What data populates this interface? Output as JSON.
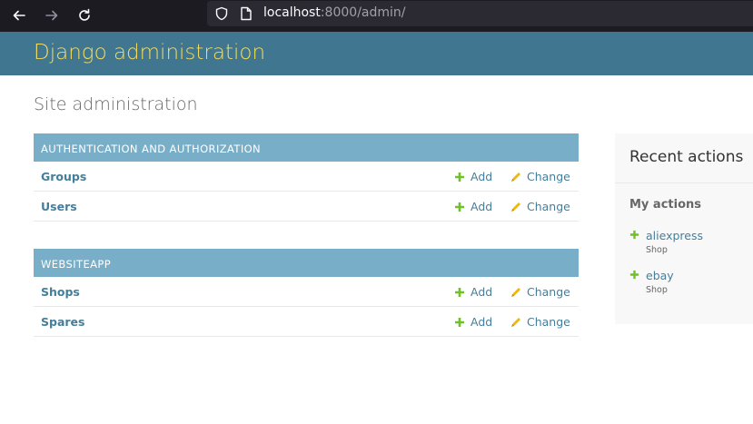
{
  "browser": {
    "url_host": "localhost",
    "url_rest": ":8000/admin/",
    "back_icon": "arrow-left-icon",
    "forward_icon": "arrow-right-icon",
    "reload_icon": "reload-icon"
  },
  "header": {
    "brand": "Django administration"
  },
  "page_title": "Site administration",
  "modules": [
    {
      "caption": "AUTHENTICATION AND AUTHORIZATION",
      "models": [
        {
          "name": "Groups",
          "add": "Add",
          "change": "Change"
        },
        {
          "name": "Users",
          "add": "Add",
          "change": "Change"
        }
      ]
    },
    {
      "caption": "WEBSITEAPP",
      "models": [
        {
          "name": "Shops",
          "add": "Add",
          "change": "Change"
        },
        {
          "name": "Spares",
          "add": "Add",
          "change": "Change"
        }
      ]
    }
  ],
  "recent_actions": {
    "title": "Recent actions",
    "subtitle": "My actions",
    "items": [
      {
        "name": "aliexpress",
        "type": "Shop"
      },
      {
        "name": "ebay",
        "type": "Shop"
      }
    ]
  },
  "colors": {
    "header_bg": "#417690",
    "brand": "#f5dd5d",
    "caption_bg": "#79aec8",
    "link": "#447e9b",
    "add_green": "#70bf2b",
    "change_yellow": "#efb80b"
  }
}
